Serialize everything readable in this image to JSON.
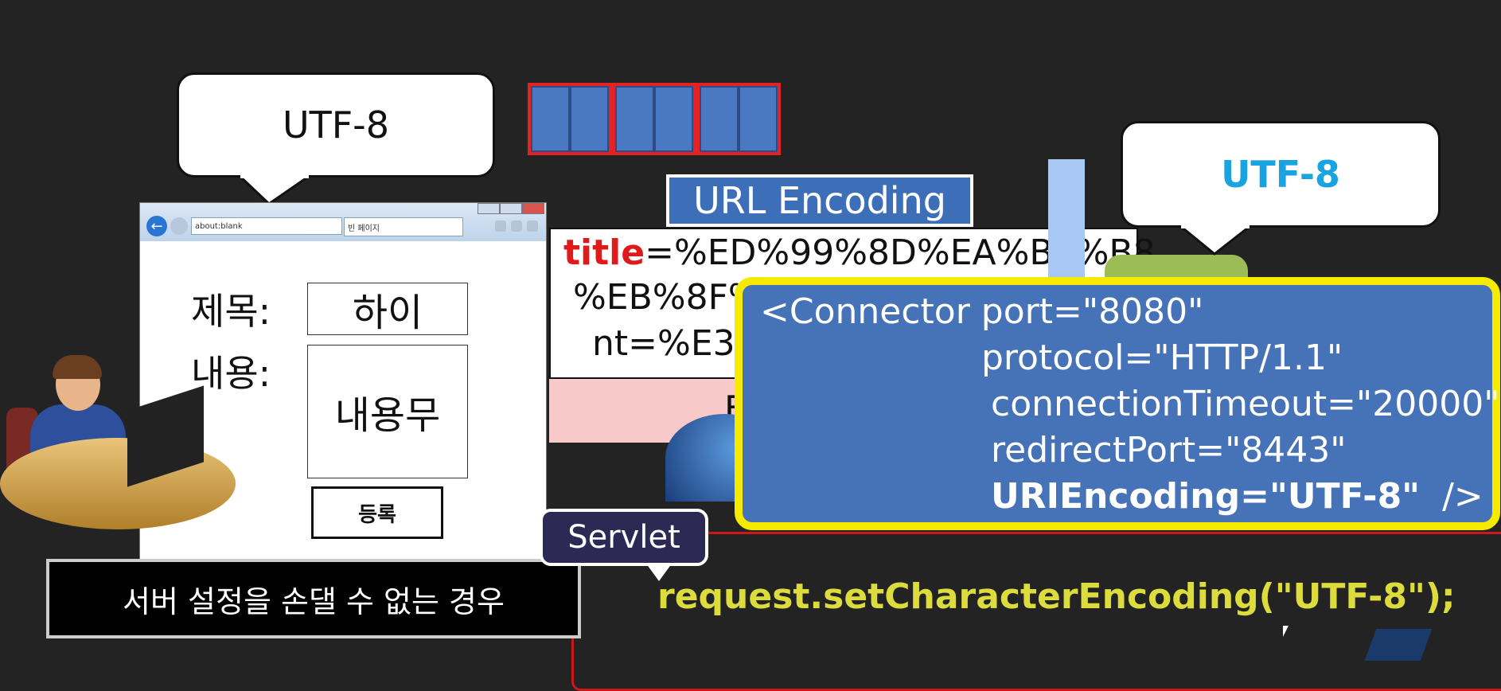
{
  "bubbles": {
    "left": "UTF-8",
    "right": "UTF-8"
  },
  "url_encoding_label": "URL Encoding",
  "encoded": {
    "title_key": "title",
    "line1_rest": "=%ED%99%8D%EA%B8%B8",
    "line2": "%EB%8F%",
    "line3": "nt=%E3%"
  },
  "pink_fragment": "F",
  "browser": {
    "address": "about:blank",
    "tab_title": "빈 페이지",
    "form": {
      "title_label": "제목:",
      "title_value": "하이",
      "content_label": "내용:",
      "content_value": "내용무",
      "submit_label": "등록"
    }
  },
  "caption": "서버 설정을 손댈 수 없는 경우",
  "servlet_label": "Servlet",
  "code": "request.setCharacterEncoding(\"UTF-8\");",
  "connector": {
    "line1": "<Connector port=\"8080\"",
    "line2": "protocol=\"HTTP/1.1\"",
    "line3": "connectionTimeout=\"20000\"",
    "line4": "redirectPort=\"8443\"",
    "line5_bold": "URIEncoding=\"UTF-8\"",
    "line5_end": "/>"
  },
  "colors": {
    "accent_yellow": "#f6ea00",
    "code_yellow": "#dcdc3c",
    "title_red": "#e01a1a",
    "utf_blue": "#19a3e0"
  }
}
